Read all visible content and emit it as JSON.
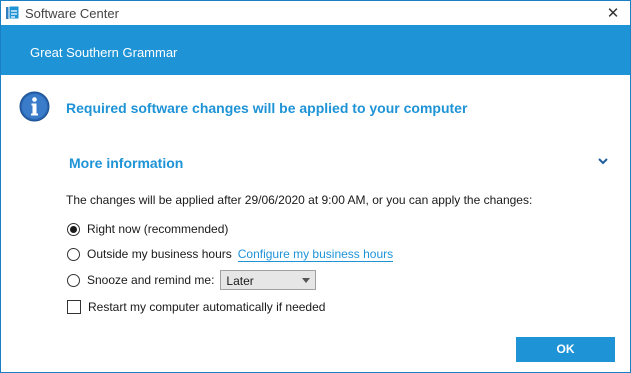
{
  "window": {
    "title": "Software Center",
    "app_icon": "software-center-icon",
    "close_glyph": "✕"
  },
  "banner": {
    "org_name": "Great Southern Grammar",
    "color": "#1e93d6"
  },
  "message": {
    "icon": "info-icon",
    "headline": "Required software changes will be applied to your computer"
  },
  "more_info": {
    "label": "More information",
    "toggle_icon": "chevron-down-icon",
    "notice": "The changes will be applied after 29/06/2020 at 9:00 AM, or you can apply the changes:",
    "options": {
      "right_now": {
        "label": "Right now (recommended)",
        "selected": true
      },
      "outside_hours": {
        "label": "Outside my business hours",
        "link": "Configure my business hours",
        "selected": false
      },
      "snooze": {
        "label": "Snooze and remind me:",
        "selected": false,
        "dropdown_value": "Later"
      }
    },
    "restart_checkbox": {
      "label": "Restart my computer automatically if needed",
      "checked": false
    }
  },
  "actions": {
    "ok_label": "OK"
  },
  "colors": {
    "accent": "#1e93d6",
    "text": "#1a1a1a",
    "window_border": "#1b7fc4"
  }
}
